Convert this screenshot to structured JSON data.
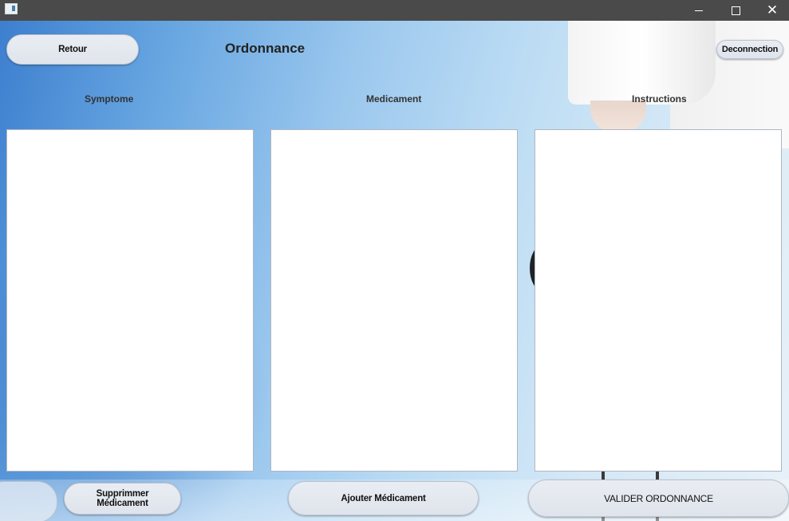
{
  "window": {
    "minimize_icon": "minimize-icon",
    "maximize_icon": "maximize-icon",
    "close_icon": "close-icon",
    "close_glyph": "✕"
  },
  "header": {
    "back_label": "Retour",
    "title": "Ordonnance",
    "logout_label": "Deconnection"
  },
  "columns": {
    "symptome_label": "Symptome",
    "medicament_label": "Medicament",
    "instructions_label": "Instructions"
  },
  "actions": {
    "remove_label": "Supprimmer Médicament",
    "add_label": "Ajouter Médicament",
    "validate_label": "VALIDER ORDONNANCE"
  },
  "colors": {
    "titlebar": "#4a4a4a",
    "background_start": "#3d7fcf",
    "background_end": "#e8f1f8",
    "panel": "#ffffff"
  }
}
